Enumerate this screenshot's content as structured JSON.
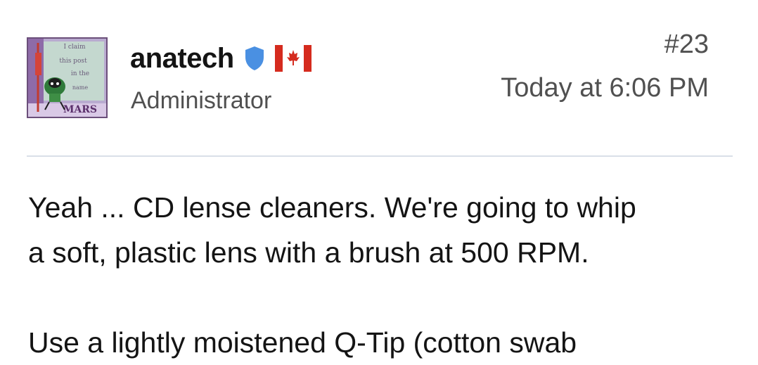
{
  "post": {
    "user": {
      "name": "anatech",
      "title": "Administrator",
      "badge_icon": "shield-icon",
      "badge_color": "#4a90e2",
      "flag_icon": "canada-flag-icon",
      "flag_color": "#d52b1e",
      "avatar_text": [
        "I claim",
        "this post",
        "in the",
        "name",
        "MARS"
      ]
    },
    "number": "#23",
    "date": "Today at 6:06 PM",
    "body": {
      "line1": "Yeah ... CD lense cleaners. We're going to whip",
      "line2": "a soft, plastic lens with a brush at 500 RPM.",
      "line3": "Use a lightly moistened Q-Tip (cotton swab"
    }
  }
}
